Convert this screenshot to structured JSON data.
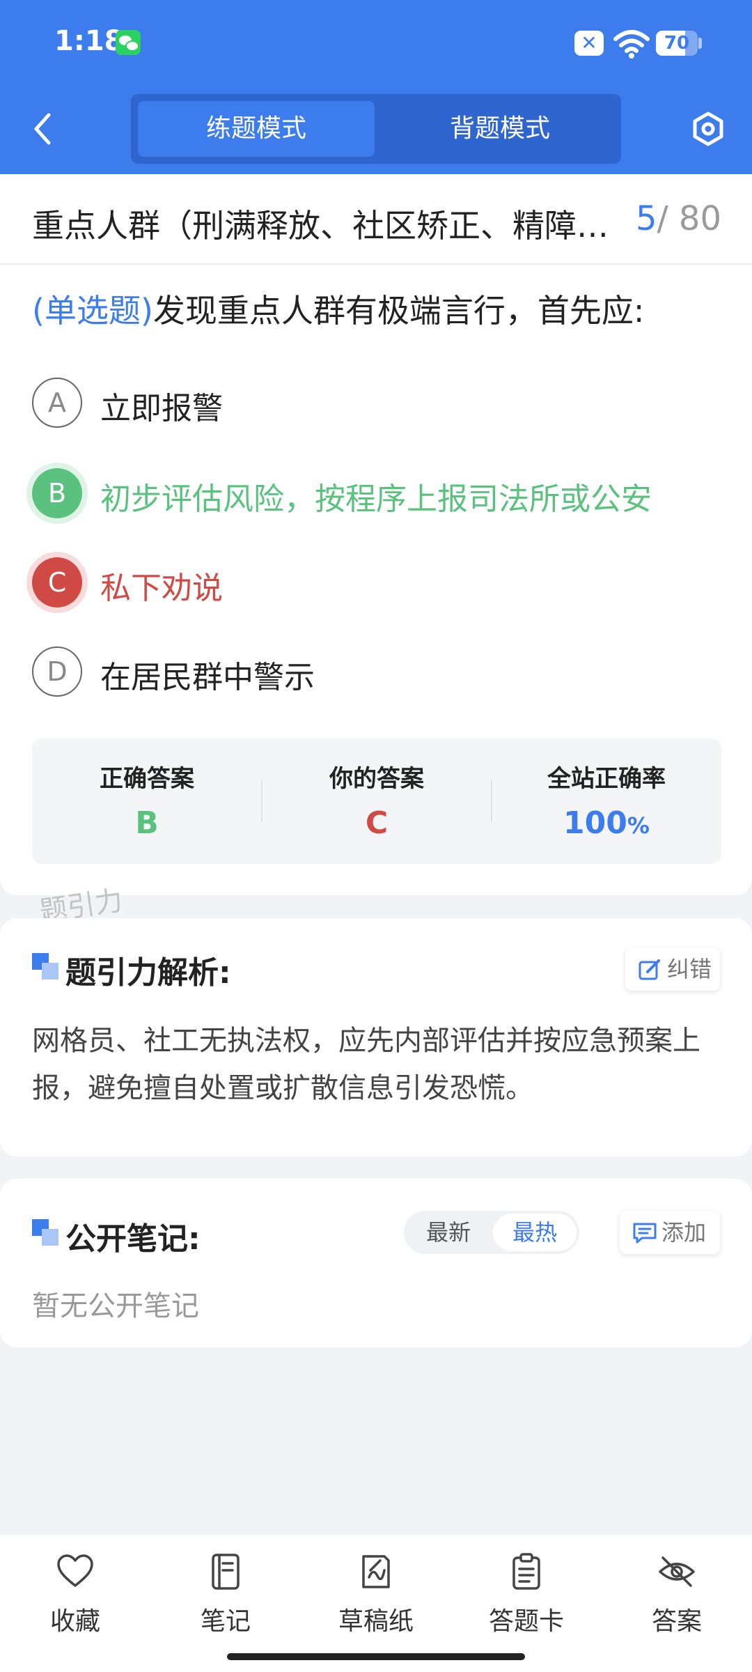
{
  "status_bar": {
    "time": "1:18",
    "sim_icon": "sim-off-icon",
    "wifi_icon": "wifi-icon",
    "battery": 70
  },
  "header": {
    "tabs": [
      {
        "label": "练题模式",
        "active": true
      },
      {
        "label": "背题模式",
        "active": false
      }
    ],
    "back_icon": "chevron-left-icon",
    "settings_icon": "hexagon-settings-icon",
    "accent": "#3c7cec"
  },
  "category": {
    "title": "重点人群（刑满释放、社区矫正、精障…",
    "current": "5",
    "total": "/ 80"
  },
  "question": {
    "type": "(单选题)",
    "text": "发现重点人群有极端言行，首先应:",
    "options": [
      {
        "letter": "A",
        "text": "立即报警",
        "state": "normal"
      },
      {
        "letter": "B",
        "text": "初步评估风险，按程序上报司法所或公安",
        "state": "correct"
      },
      {
        "letter": "C",
        "text": "私下劝说",
        "state": "wrong"
      },
      {
        "letter": "D",
        "text": "在居民群中警示",
        "state": "normal"
      }
    ]
  },
  "result": {
    "correct_label": "正确答案",
    "correct_value": "B",
    "yours_label": "你的答案",
    "yours_value": "C",
    "rate_label": "全站正确率",
    "rate_value": "100",
    "rate_unit": "%"
  },
  "colors": {
    "correct": "#5ac17e",
    "wrong": "#d04a45"
  },
  "watermark": "题引力",
  "analysis": {
    "title": "题引力解析:",
    "report_label": "纠错",
    "text": "网格员、社工无执法权，应先内部评估并按应急预案上报，避免擅自处置或扩散信息引发恐慌。"
  },
  "notes": {
    "title": "公开笔记:",
    "sort_options": [
      "最新",
      "最热"
    ],
    "sort_selected": "最热",
    "add_label": "添加",
    "empty_text": "暂无公开笔记"
  },
  "bottom_bar": [
    {
      "label": "收藏",
      "icon": "heart-icon"
    },
    {
      "label": "笔记",
      "icon": "notebook-icon"
    },
    {
      "label": "草稿纸",
      "icon": "draft-paper-icon"
    },
    {
      "label": "答题卡",
      "icon": "answer-sheet-icon"
    },
    {
      "label": "答案",
      "icon": "eye-off-icon"
    }
  ]
}
